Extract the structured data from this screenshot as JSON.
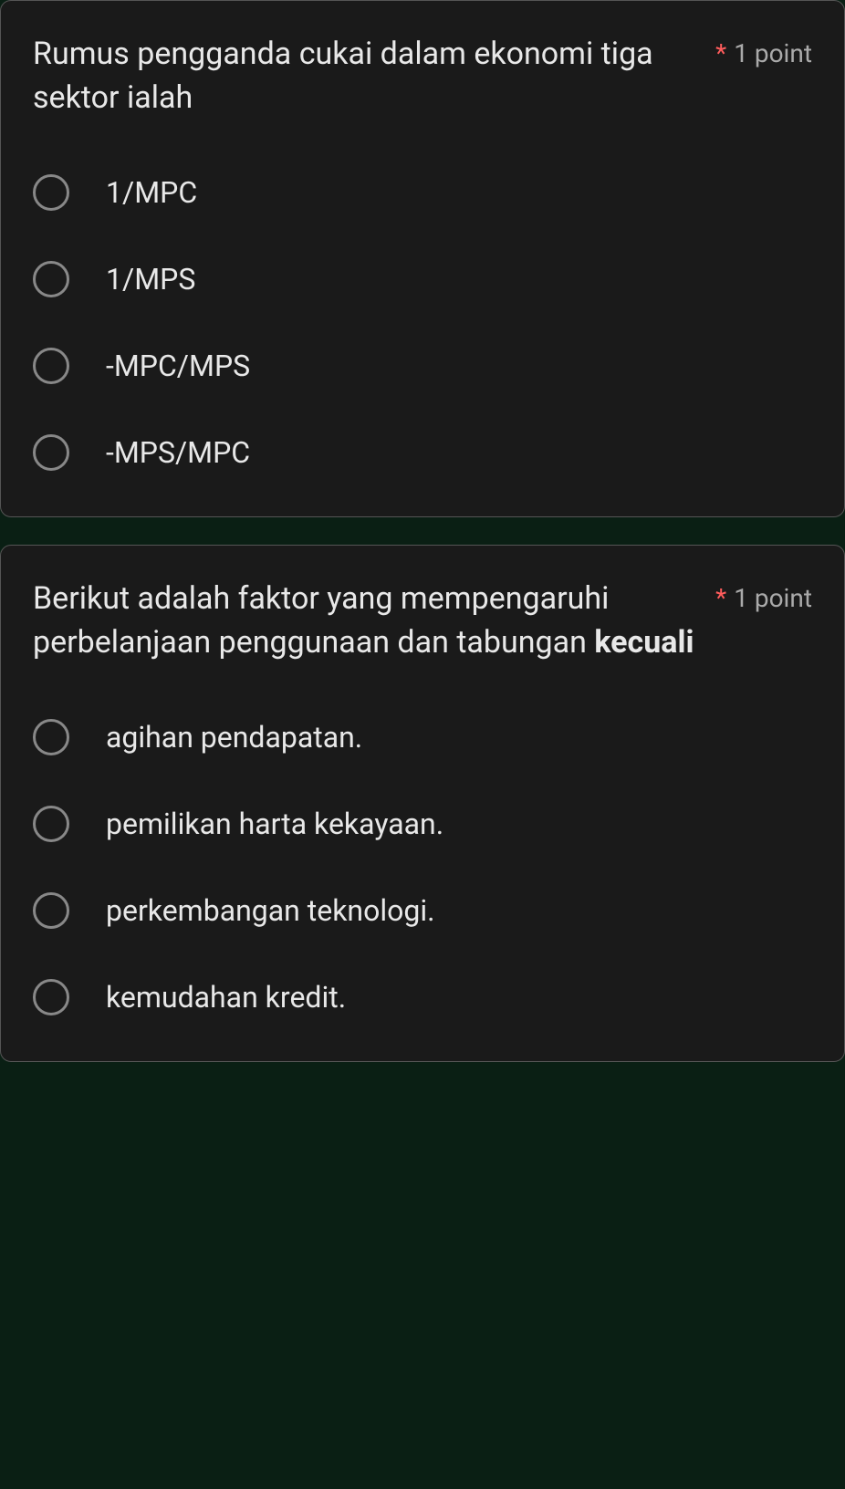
{
  "questions": [
    {
      "text_plain": "Rumus pengganda cukai dalam ekonomi tiga sektor ialah",
      "text_bold": "",
      "required_mark": "*",
      "points": "1 point",
      "options": [
        "1/MPC",
        "1/MPS",
        "-MPC/MPS",
        "-MPS/MPC"
      ]
    },
    {
      "text_plain": "Berikut adalah faktor yang mempengaruhi perbelanjaan penggunaan dan tabungan ",
      "text_bold": "kecuali",
      "required_mark": "*",
      "points": "1 point",
      "options": [
        "agihan pendapatan.",
        "pemilikan harta kekayaan.",
        "perkembangan teknologi.",
        "kemudahan kredit."
      ]
    }
  ]
}
